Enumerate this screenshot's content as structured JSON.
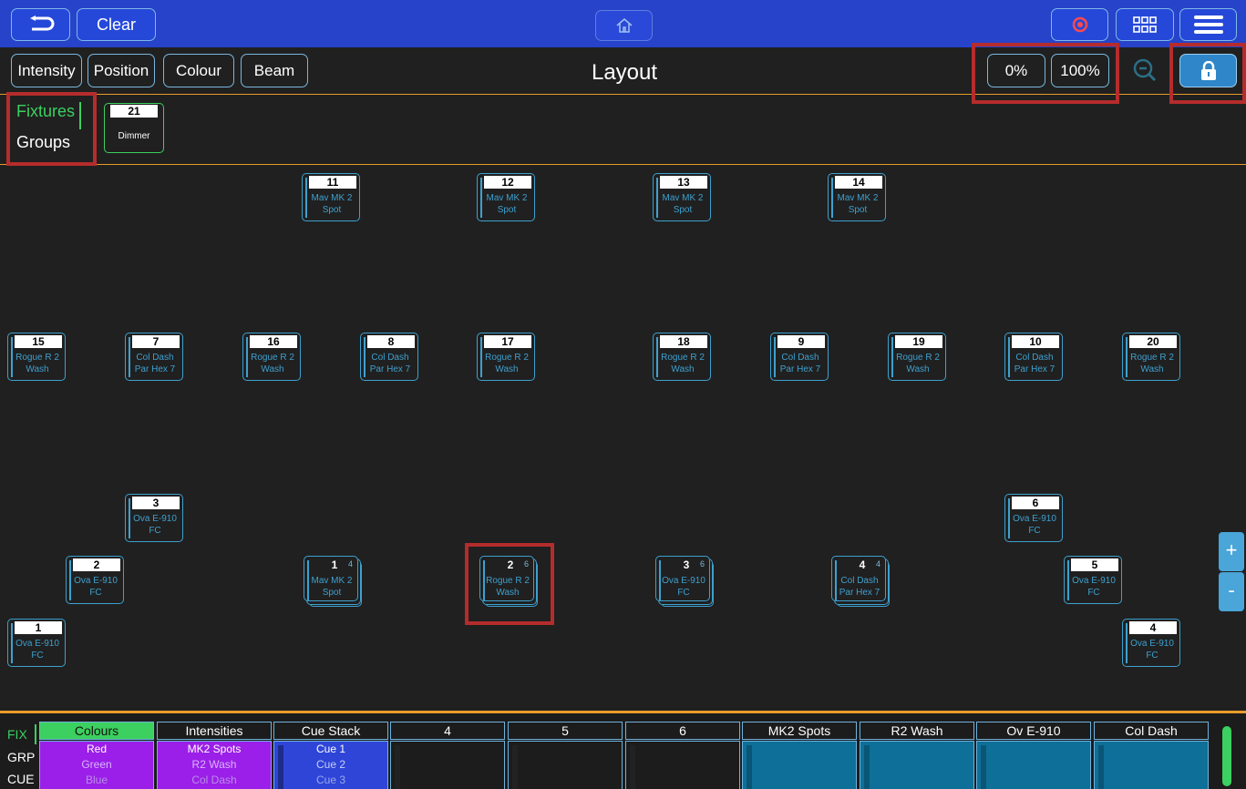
{
  "topbar": {
    "clear_label": "Clear"
  },
  "toolbar": {
    "intensity_label": "Intensity",
    "position_label": "Position",
    "colour_label": "Colour",
    "beam_label": "Beam",
    "title": "Layout",
    "zero_label": "0%",
    "full_label": "100%"
  },
  "tabs": {
    "fixtures_label": "Fixtures",
    "groups_label": "Groups",
    "active": "Fixtures"
  },
  "dimmer_tile": {
    "number": "21",
    "label": "Dimmer"
  },
  "fixtures": [
    {
      "number": "11",
      "line1": "Mav MK 2",
      "line2": "Spot"
    },
    {
      "number": "12",
      "line1": "Mav MK 2",
      "line2": "Spot"
    },
    {
      "number": "13",
      "line1": "Mav MK 2",
      "line2": "Spot"
    },
    {
      "number": "14",
      "line1": "Mav MK 2",
      "line2": "Spot"
    },
    {
      "number": "15",
      "line1": "Rogue R 2",
      "line2": "Wash"
    },
    {
      "number": "7",
      "line1": "Col Dash",
      "line2": "Par Hex 7"
    },
    {
      "number": "16",
      "line1": "Rogue R 2",
      "line2": "Wash"
    },
    {
      "number": "8",
      "line1": "Col Dash",
      "line2": "Par Hex 7"
    },
    {
      "number": "17",
      "line1": "Rogue R 2",
      "line2": "Wash"
    },
    {
      "number": "18",
      "line1": "Rogue R 2",
      "line2": "Wash"
    },
    {
      "number": "9",
      "line1": "Col Dash",
      "line2": "Par Hex 7"
    },
    {
      "number": "19",
      "line1": "Rogue R 2",
      "line2": "Wash"
    },
    {
      "number": "10",
      "line1": "Col Dash",
      "line2": "Par Hex 7"
    },
    {
      "number": "20",
      "line1": "Rogue R 2",
      "line2": "Wash"
    },
    {
      "number": "3",
      "line1": "Ova E-910",
      "line2": "FC"
    },
    {
      "number": "6",
      "line1": "Ova E-910",
      "line2": "FC"
    },
    {
      "number": "2",
      "line1": "Ova E-910",
      "line2": "FC"
    },
    {
      "number": "5",
      "line1": "Ova E-910",
      "line2": "FC"
    },
    {
      "number": "1",
      "line1": "Ova E-910",
      "line2": "FC"
    },
    {
      "number": "4",
      "line1": "Ova E-910",
      "line2": "FC"
    }
  ],
  "groups": [
    {
      "number": "1",
      "count": "4",
      "line1": "Mav MK 2",
      "line2": "Spot"
    },
    {
      "number": "2",
      "count": "6",
      "line1": "Rogue R 2",
      "line2": "Wash"
    },
    {
      "number": "3",
      "count": "6",
      "line1": "Ova E-910",
      "line2": "FC"
    },
    {
      "number": "4",
      "count": "4",
      "line1": "Col Dash",
      "line2": "Par Hex 7"
    }
  ],
  "zoom": {
    "plus": "+",
    "minus": "-"
  },
  "modes": {
    "fix": "FIX",
    "grp": "GRP",
    "cue": "CUE"
  },
  "playbacks": [
    {
      "title": "Colours",
      "lines": [
        "Red",
        "Green",
        "Blue"
      ],
      "header_color": "#3bd05f",
      "body_color": "#9b1fe8"
    },
    {
      "title": "Intensities",
      "lines": [
        "MK2 Spots",
        "R2 Wash",
        "Col Dash"
      ],
      "header_color": "#1c1c1c",
      "body_color": "#9b1fe8"
    },
    {
      "title": "Cue Stack",
      "lines": [
        "Cue 1",
        "Cue 2",
        "Cue 3"
      ],
      "header_color": "#1c1c1c",
      "body_color": "#2f45d8"
    },
    {
      "title": "4",
      "lines": [
        "",
        "",
        ""
      ],
      "header_color": "#1c1c1c",
      "body_color": "#1c1c1c"
    },
    {
      "title": "5",
      "lines": [
        "",
        "",
        ""
      ],
      "header_color": "#1c1c1c",
      "body_color": "#1c1c1c"
    },
    {
      "title": "6",
      "lines": [
        "",
        "",
        ""
      ],
      "header_color": "#1c1c1c",
      "body_color": "#1c1c1c"
    },
    {
      "title": "MK2 Spots",
      "lines": [
        "",
        "",
        ""
      ],
      "header_color": "#1c1c1c",
      "body_color": "#0e6f98"
    },
    {
      "title": "R2 Wash",
      "lines": [
        "",
        "",
        ""
      ],
      "header_color": "#1c1c1c",
      "body_color": "#0e6f98"
    },
    {
      "title": "Ov E-910",
      "lines": [
        "",
        "",
        ""
      ],
      "header_color": "#1c1c1c",
      "body_color": "#0e6f98"
    },
    {
      "title": "Col Dash",
      "lines": [
        "",
        "",
        ""
      ],
      "header_color": "#1c1c1c",
      "body_color": "#0e6f98"
    }
  ],
  "colors": {
    "accent_blue": "#2743c9",
    "tile_blue": "#3ea0cf",
    "green": "#3bd05f",
    "orange_divider": "#e99b2a",
    "highlight_red": "#b52c2c"
  }
}
